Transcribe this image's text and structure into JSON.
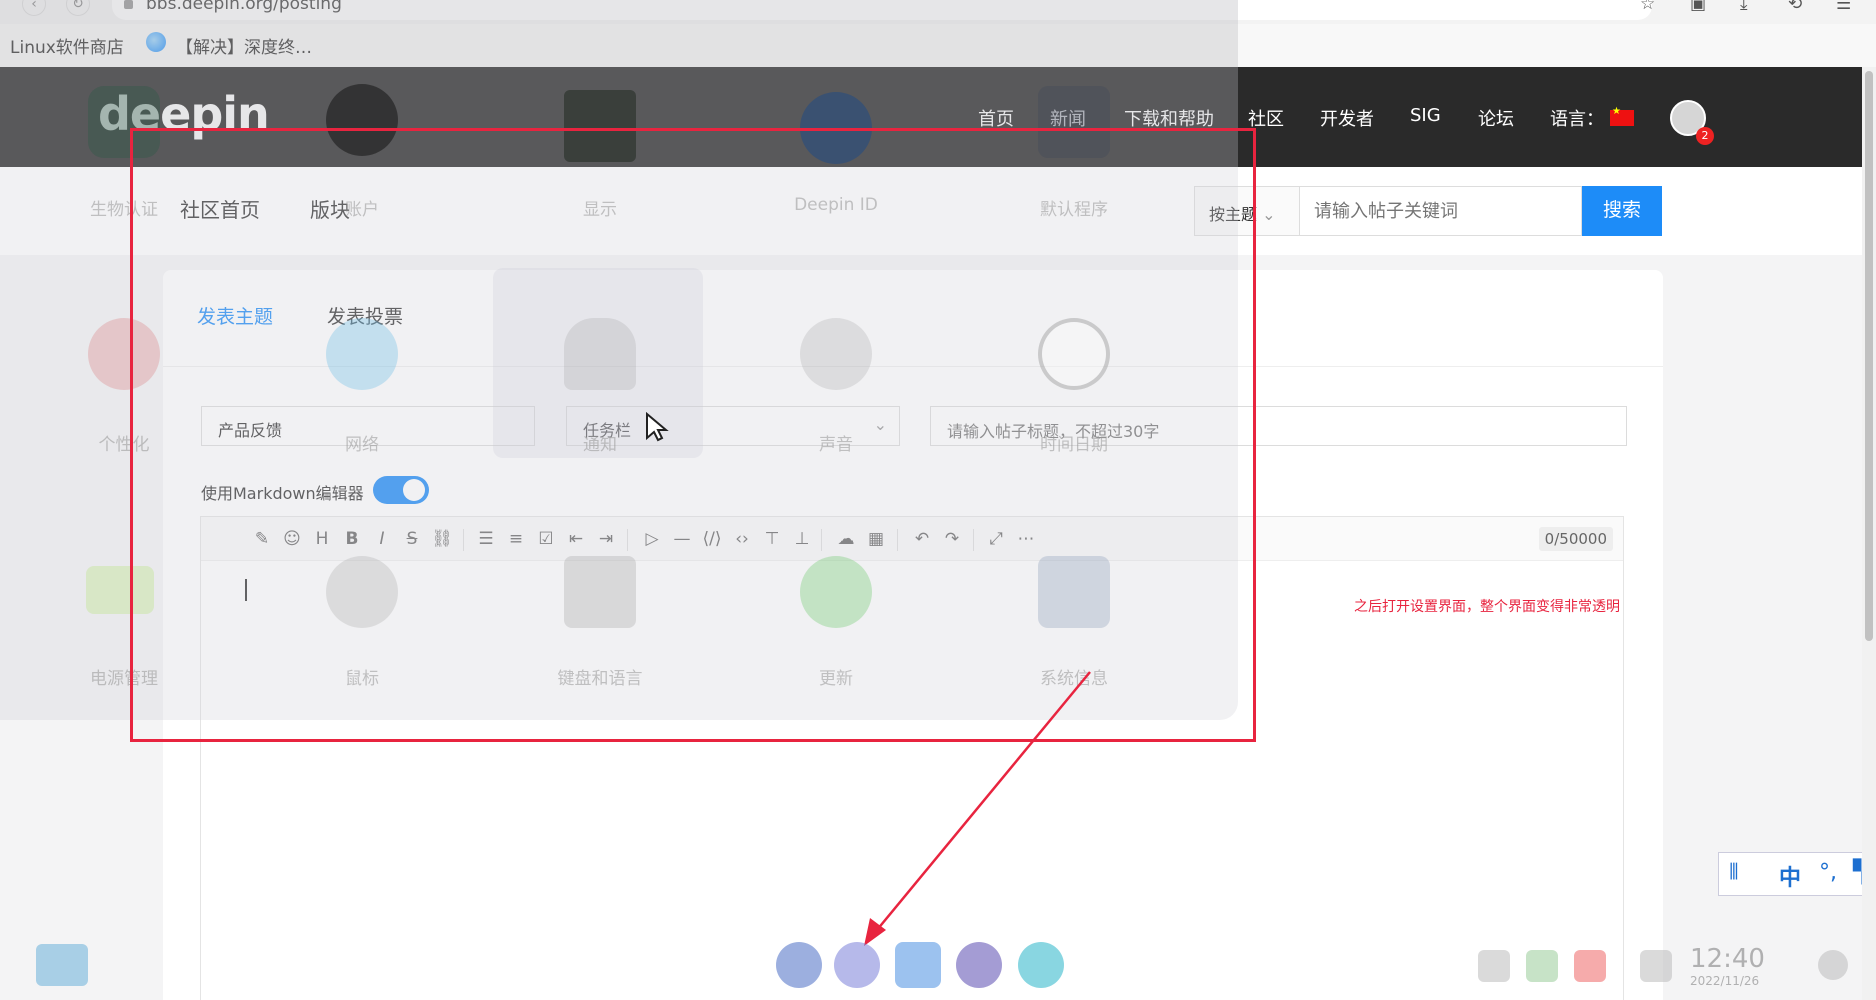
{
  "browser": {
    "url": "bbs.deepin.org/posting",
    "bookmarks": [
      "Linux软件商店",
      "【解决】深度终…"
    ]
  },
  "header": {
    "logo": "deepin",
    "nav": [
      "首页",
      "新闻",
      "下载和帮助",
      "社区",
      "开发者",
      "SIG",
      "论坛",
      "语言："
    ],
    "badge_count": "2"
  },
  "subnav": {
    "links": [
      "社区首页",
      "版块"
    ],
    "search_scope": "按主题",
    "search_placeholder": "请输入帖子关键词",
    "search_button": "搜索"
  },
  "post": {
    "tabs": [
      "发表主题",
      "发表投票"
    ],
    "category": "产品反馈",
    "subcategory": "任务栏",
    "title_placeholder": "请输入帖子标题，不超过30字",
    "markdown_label": "使用Markdown编辑器",
    "markdown_enabled": true,
    "char_counter": "0/50000"
  },
  "settings_overlay": {
    "modules_row1": [
      "生物认证",
      "账户",
      "显示",
      "Deepin ID",
      "默认程序"
    ],
    "modules_row2": [
      "个性化",
      "网络",
      "通知",
      "声音",
      "时间日期"
    ],
    "modules_row3": [
      "电源管理",
      "鼠标",
      "键盘和语言",
      "更新",
      "系统信息"
    ]
  },
  "annotation": {
    "text": "之后打开设置界面，整个界面变得非常透明",
    "color": "#e8243f"
  },
  "tray": {
    "time": "12:40",
    "date": "2022/11/26",
    "ime_mode": "中"
  },
  "colors": {
    "accent": "#1d8cf8",
    "header_bg": "#2a2a2a",
    "annotation": "#e8243f"
  }
}
